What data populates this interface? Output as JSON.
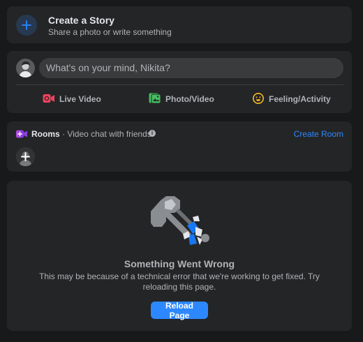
{
  "story": {
    "title": "Create a Story",
    "subtitle": "Share a photo or write something",
    "icon": "plus-icon"
  },
  "composer": {
    "placeholder": "What's on your mind, Nikita?",
    "actions": [
      {
        "label": "Live Video",
        "icon": "live-video-icon",
        "color": "#f3425f"
      },
      {
        "label": "Photo/Video",
        "icon": "photo-video-icon",
        "color": "#45bd62"
      },
      {
        "label": "Feeling/Activity",
        "icon": "feeling-icon",
        "color": "#f7b928"
      }
    ]
  },
  "rooms": {
    "title": "Rooms",
    "subtitle": " · Video chat with friends",
    "create_label": "Create Room",
    "icon": "rooms-video-icon",
    "accent": "#2d88ff"
  },
  "error": {
    "title": "Something Went Wrong",
    "message": "This may be because of a technical error that we're working to get fixed. Try reloading this page.",
    "button_label": "Reload Page",
    "illustration": "broken-wrench-icon"
  }
}
